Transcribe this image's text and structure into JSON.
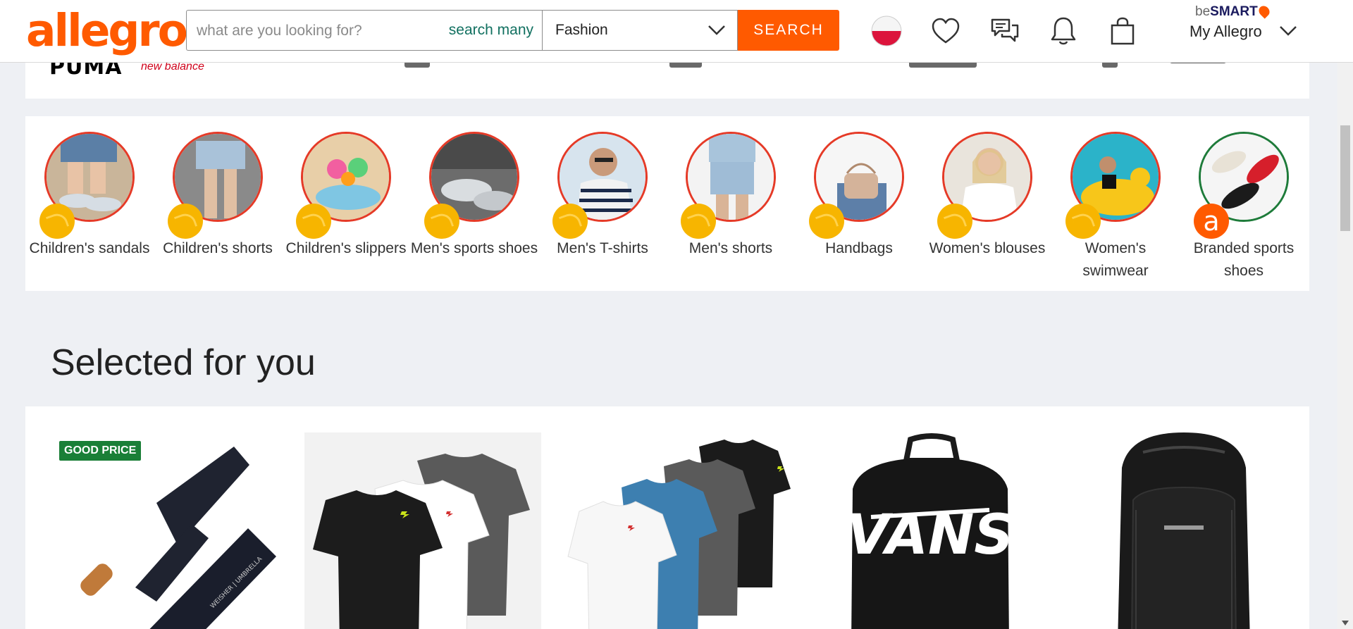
{
  "header": {
    "logo": "allegro",
    "search_placeholder": "what are you looking for?",
    "search_many": "search many",
    "category": "Fashion",
    "search_button": "SEARCH",
    "besmart_prefix": "be",
    "besmart_brand": "SMART",
    "my_allegro": "My Allegro",
    "icons": [
      "poland-flag-icon",
      "heart-icon",
      "messages-icon",
      "bell-icon",
      "shopping-bag-icon",
      "chevron-down-icon"
    ]
  },
  "brand_strip": {
    "puma": "PUMA",
    "new_balance": "new balance"
  },
  "categories": [
    {
      "label": "Children's sandals"
    },
    {
      "label": "Children's shorts"
    },
    {
      "label": "Children's slippers"
    },
    {
      "label": "Men's sports shoes"
    },
    {
      "label": "Men's T-shirts"
    },
    {
      "label": "Men's shorts"
    },
    {
      "label": "Handbags"
    },
    {
      "label": "Women's blouses"
    },
    {
      "label": "Women's swimwear"
    },
    {
      "label": "Branded sports shoes"
    }
  ],
  "selected": {
    "title": "Selected for you",
    "good_price": "GOOD PRICE",
    "products": [
      "umbrella",
      "t-shirts-3pack",
      "t-shirts-4pack",
      "vans-backpack",
      "black-backpack"
    ],
    "vans_text": "VANS",
    "umbrella_text": "WEISHER | UMBRELLA"
  },
  "colors": {
    "brand": "#ff5a00",
    "accent_green": "#117060",
    "badge_green": "#1a7f37"
  }
}
